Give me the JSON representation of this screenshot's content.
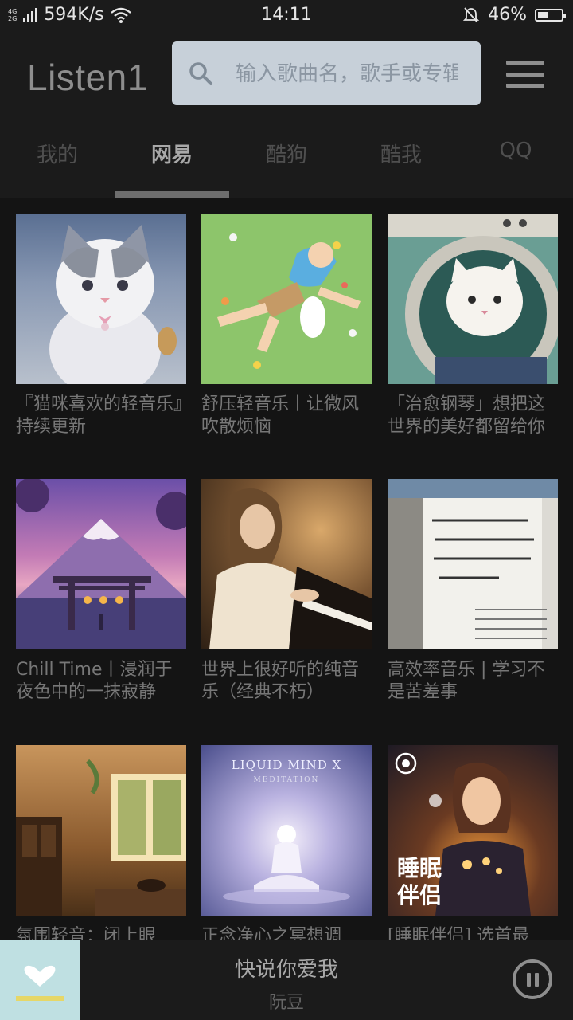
{
  "status_bar": {
    "network_label_top": "4G",
    "network_label_bottom": "2G",
    "speed": "594K/s",
    "time": "14:11",
    "battery": "46%",
    "battery_level": 0.46
  },
  "header": {
    "app_title": "Listen1",
    "search_placeholder": "输入歌曲名，歌手或专辑",
    "menu_icon": "hamburger-icon"
  },
  "tabs": [
    {
      "label": "我的",
      "active": false
    },
    {
      "label": "网易",
      "active": true
    },
    {
      "label": "酷狗",
      "active": false
    },
    {
      "label": "酷我",
      "active": false
    },
    {
      "label": "QQ",
      "active": false
    }
  ],
  "playlists": [
    {
      "title": "『猫咪喜欢的轻音乐』持续更新"
    },
    {
      "title": "舒压轻音乐丨让微风吹散烦恼"
    },
    {
      "title": "「治愈钢琴」想把这世界的美好都留给你"
    },
    {
      "title": "Chill Time丨浸润于夜色中的一抹寂静"
    },
    {
      "title": "世界上很好听的纯音乐（经典不朽）"
    },
    {
      "title": "高效率音乐 | 学习不是苦差事"
    },
    {
      "title": "氛围轻音：闭上眼"
    },
    {
      "title": "正念净心之冥想调"
    },
    {
      "title": "[睡眠伴侣] 选首最"
    }
  ],
  "artwork_text": {
    "card5": "LIQUID MIND X",
    "card5_sub": "MEDITATION",
    "card8_line1": "睡眠",
    "card8_line2": "伴侣"
  },
  "player": {
    "song": "快说你爱我",
    "artist": "阮豆",
    "state_icon": "pause-icon"
  }
}
